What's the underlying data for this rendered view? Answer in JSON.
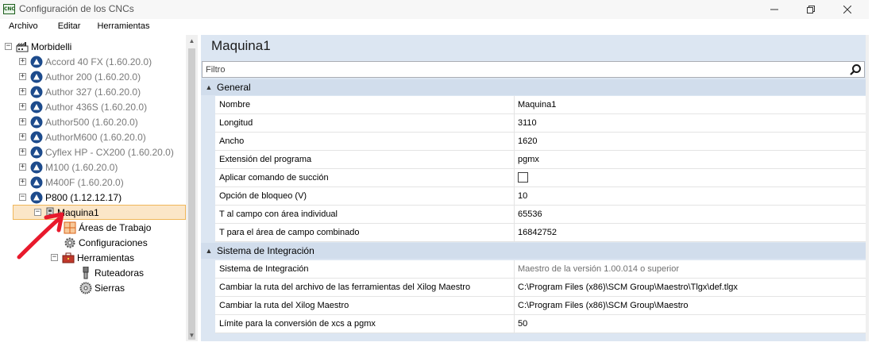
{
  "window": {
    "title": "Configuración de los CNCs",
    "app_icon_text": "CNC"
  },
  "menu": [
    {
      "label": "Archivo"
    },
    {
      "label": "Editar"
    },
    {
      "label": "Herramientas"
    }
  ],
  "tree": {
    "root": {
      "label": "Morbidelli",
      "icon": "factory-icon",
      "expander": "minus"
    },
    "machines": [
      {
        "label": "Accord 40 FX (1.60.20.0)",
        "icon": "cnc-logo-icon",
        "greyed": true
      },
      {
        "label": "Author 200 (1.60.20.0)",
        "icon": "cnc-logo-icon",
        "greyed": true
      },
      {
        "label": "Author 327 (1.60.20.0)",
        "icon": "cnc-logo-icon",
        "greyed": true
      },
      {
        "label": "Author 436S (1.60.20.0)",
        "icon": "cnc-logo-icon",
        "greyed": true
      },
      {
        "label": "Author500 (1.60.20.0)",
        "icon": "cnc-logo-icon",
        "greyed": true
      },
      {
        "label": "AuthorM600 (1.60.20.0)",
        "icon": "cnc-logo-icon",
        "greyed": true
      },
      {
        "label": "Cyflex HP - CX200 (1.60.20.0)",
        "icon": "cnc-logo-icon",
        "greyed": true
      },
      {
        "label": "M100 (1.60.20.0)",
        "icon": "cnc-logo-icon",
        "greyed": true
      },
      {
        "label": "M400F (1.60.20.0)",
        "icon": "cnc-logo-icon",
        "greyed": true
      },
      {
        "label": "P800 (1.12.12.17)",
        "icon": "cnc-logo-icon",
        "greyed": false
      }
    ],
    "selected": {
      "label": "Maquina1",
      "icon": "machine-icon"
    },
    "children": [
      {
        "label": "Áreas de Trabajo",
        "icon": "work-areas-icon"
      },
      {
        "label": "Configuraciones",
        "icon": "gear-icon"
      },
      {
        "label": "Herramientas",
        "icon": "toolbox-icon"
      }
    ],
    "tools": [
      {
        "label": "Ruteadoras",
        "icon": "router-bit-icon"
      },
      {
        "label": "Sierras",
        "icon": "saw-blade-icon"
      }
    ]
  },
  "details": {
    "title": "Maquina1",
    "filter_placeholder": "Filtro",
    "sections": [
      {
        "label": "General",
        "rows": [
          {
            "name": "Nombre",
            "value": "Maquina1"
          },
          {
            "name": "Longitud",
            "value": "3110"
          },
          {
            "name": "Ancho",
            "value": "1620"
          },
          {
            "name": "Extensión del programa",
            "value": "pgmx"
          },
          {
            "name": "Aplicar comando de succión",
            "value": "",
            "checkbox": true,
            "checked": false
          },
          {
            "name": "Opción de bloqueo (V)",
            "value": "10"
          },
          {
            "name": "T al campo con área individual",
            "value": "65536"
          },
          {
            "name": "T para el área de campo combinado",
            "value": "16842752"
          }
        ]
      },
      {
        "label": "Sistema de Integración",
        "rows": [
          {
            "name": "Sistema de Integración",
            "value": "Maestro de la versión 1.00.014 o superior",
            "muted": true
          },
          {
            "name": "Cambiar la ruta del archivo de las ferramientas del Xilog Maestro",
            "value": "C:\\Program Files (x86)\\SCM Group\\Maestro\\Tlgx\\def.tlgx"
          },
          {
            "name": "Cambiar la ruta del Xilog Maestro",
            "value": "C:\\Program Files (x86)\\SCM Group\\Maestro"
          },
          {
            "name": "Límite para la conversión de xcs a pgmx",
            "value": "50"
          }
        ]
      }
    ]
  },
  "colors": {
    "selection_bg": "#fbe6c8",
    "panel_bg": "#dce6f2",
    "section_bg": "#d1ddec",
    "annotation_arrow": "#e8192c"
  }
}
